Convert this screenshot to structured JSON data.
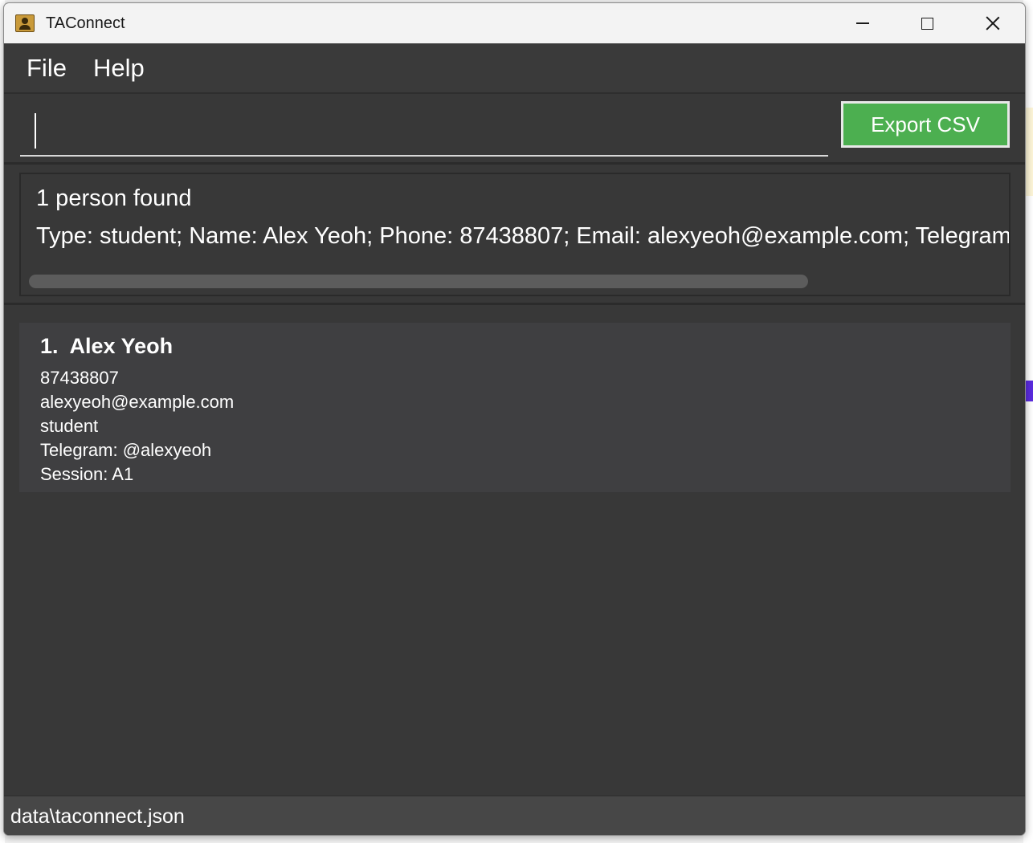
{
  "window": {
    "title": "TAConnect"
  },
  "menu": {
    "items": [
      {
        "label": "File"
      },
      {
        "label": "Help"
      }
    ]
  },
  "command": {
    "value": "",
    "export_label": "Export CSV"
  },
  "result": {
    "summary": "1 person found",
    "detail": "Type: student; Name: Alex Yeoh; Phone: 87438807; Email: alexyeoh@example.com; Telegram: @"
  },
  "persons": [
    {
      "index": "1.",
      "name": "Alex Yeoh",
      "phone": "87438807",
      "email": "alexyeoh@example.com",
      "type": "student",
      "telegram": "Telegram: @alexyeoh",
      "session": "Session: A1"
    }
  ],
  "status": {
    "path": "data\\taconnect.json"
  },
  "colors": {
    "export_button": "#4caf50",
    "background": "#383838"
  }
}
